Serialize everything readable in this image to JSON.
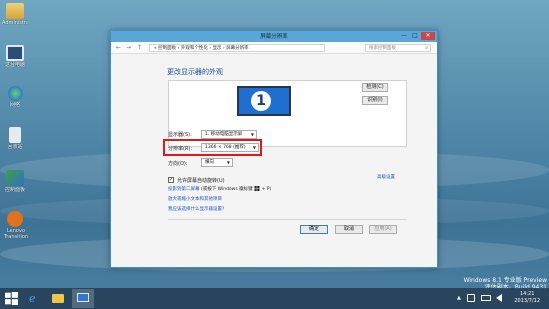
{
  "desktop": {
    "icons": [
      {
        "label": "Administrator",
        "icon": "user-folder-icon"
      },
      {
        "label": "这台电脑",
        "icon": "computer-icon"
      },
      {
        "label": "网络",
        "icon": "network-icon"
      },
      {
        "label": "回收站",
        "icon": "recycle-bin-icon"
      },
      {
        "label": "控制面板",
        "icon": "control-panel-icon"
      },
      {
        "label": "Lenovo Transition",
        "icon": "lenovo-transition-icon"
      }
    ],
    "watermark": {
      "line1": "Windows 8.1 专业版 Preview",
      "line2": "评估副本。Build 9431"
    }
  },
  "window": {
    "title": "屏幕分辨率",
    "controls": {
      "minimize": "—",
      "maximize": "□",
      "close": "✕"
    },
    "address": {
      "back": "←",
      "forward": "→",
      "up": "↑",
      "breadcrumb": "« 控制面板 › 外观和个性化 › 显示 › 屏幕分辨率",
      "search_placeholder": "搜索控制面板"
    },
    "heading": "更改显示器的外观",
    "monitor_number": "1",
    "detect_button": "检测(C)",
    "identify_button": "识别(I)",
    "display": {
      "label": "显示器(S):",
      "value": "1. 移动电脑显示屏"
    },
    "resolution": {
      "label": "分辨率(R):",
      "value": "1366 × 768 (推荐)"
    },
    "orientation": {
      "label": "方向(O):",
      "value": "横向"
    },
    "advanced_link": "高级设置",
    "checkbox": {
      "checked": true,
      "mark": "✓",
      "label": "允许屏幕自动旋转(U)"
    },
    "projector_link": {
      "text": "投影到第二屏幕",
      "suffix": "(或按下 Windows 徽标键",
      "keys": "+ P)"
    },
    "text_size_link": "放大或缩小文本和其他项目",
    "help_link": "我应该选择什么显示器设置?",
    "ok_button": "确定",
    "cancel_button": "取消",
    "apply_button": "应用(A)"
  },
  "taskbar": {
    "tray_up": "▲",
    "time": "14:21",
    "date": "2013/7/12"
  }
}
